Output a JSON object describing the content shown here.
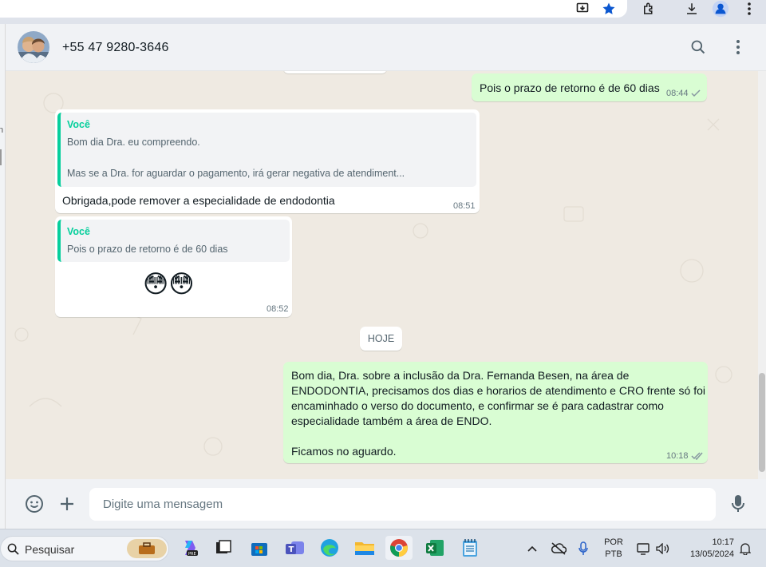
{
  "contact": {
    "phone": "+55 47 9280-3646"
  },
  "messages": [
    {
      "time": "08:44",
      "text": "Pois o prazo de retorno é de 60 dias",
      "status": "single-check"
    },
    {
      "quote_author": "Você",
      "quote_line1": "Bom dia Dra. eu compreendo.",
      "quote_line2": "Mas se a Dra. for aguardar o pagamento, irá gerar negativa de atendiment...",
      "text": "Obrigada,pode remover a especialidade de endodontia",
      "time": "08:51"
    },
    {
      "quote_author": "Você",
      "quote_line1": "Pois o prazo de retorno é de 60 dias",
      "emoji": "😳😳",
      "time": "08:52"
    },
    {
      "text": "Bom dia, Dra. sobre a inclusão da Dra. Fernanda Besen, na área de ENDODONTIA, precisamos dos dias e horarios de atendimento e CRO frente só foi encaminhado o verso do documento, e confirmar se é para cadastrar como especialidade também a área de ENDO.\n\nFicamos no aguardo.",
      "time": "10:18",
      "status": "double-check"
    }
  ],
  "day_divider": "HOJE",
  "composer": {
    "placeholder": "Digite uma mensagem"
  },
  "taskbar": {
    "search_label": "Pesquisar",
    "lang_top": "POR",
    "lang_bottom": "PTB",
    "clock_time": "10:17",
    "clock_date": "13/05/2024"
  },
  "colors": {
    "outgoing": "#d9fdd3",
    "incoming": "#ffffff",
    "accent": "#06cf9c",
    "chat_bg": "#efeae2"
  }
}
